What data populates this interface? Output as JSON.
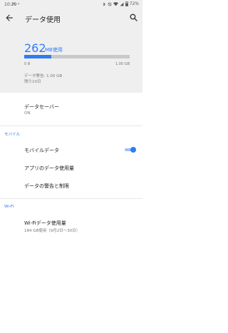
{
  "status_bar": {
    "time": "10:29",
    "left_icons": "✉ •",
    "battery": "72%"
  },
  "app_bar": {
    "title": "データ使用"
  },
  "usage": {
    "amount": "262",
    "unit": "MB使用",
    "progress_fraction": 0.26,
    "range_start": "0 B",
    "range_end": "1.00 GB",
    "warning": "データ警告: 1.00 GB",
    "remaining": "残り10日"
  },
  "data_saver": {
    "title": "データセーバー",
    "status": "ON"
  },
  "mobile_section": {
    "header": "モバイル",
    "mobile_data_label": "モバイルデータ",
    "mobile_data_enabled": true,
    "app_usage_label": "アプリのデータ使用量",
    "warning_limit_label": "データの警告と制限"
  },
  "wifi_section": {
    "header": "Wi-Fi",
    "usage_label": "Wi-Fiデータ使用量",
    "usage_detail": "184 GB使用（9月2日～30日）"
  },
  "colors": {
    "accent": "#2f7cf3",
    "panel_bg": "#efefef"
  }
}
